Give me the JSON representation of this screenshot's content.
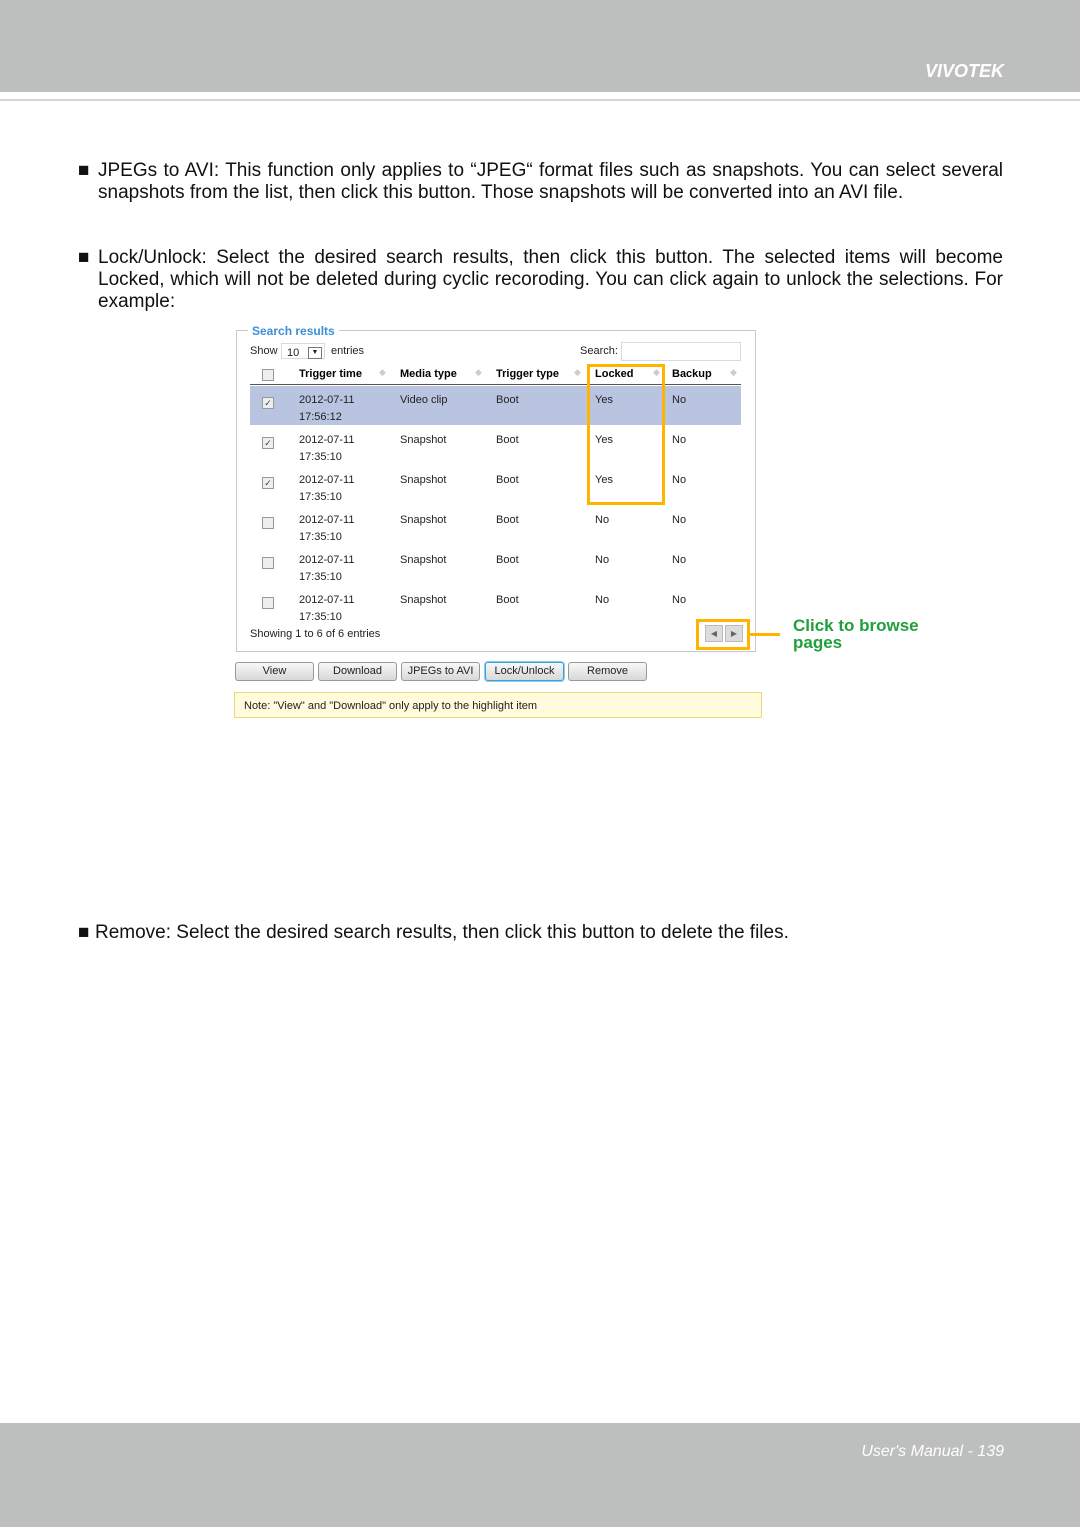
{
  "header": {
    "brand": "VIVOTEK"
  },
  "footer": {
    "page": "User's Manual - 139"
  },
  "paragraphs": [
    "JPEGs to AVI: This function only applies to “JPEG“ format files such as snapshots. You can select several snapshots from the list, then click this button. Those snapshots will be converted into an AVI file.",
    "Lock/Unlock: Select the desired search results, then click this button. The selected items will become Locked, which will not be deleted during cyclic recoroding. You can click again to unlock the selections. For example:",
    "Remove: Select the desired search results, then click this button to delete the files."
  ],
  "bullet": "■",
  "panel": {
    "legend": "Search results",
    "show": "Show",
    "entries_value": "10",
    "entries": "entries",
    "search_label": "Search:",
    "search_value": "",
    "columns": [
      "Trigger time",
      "Media type",
      "Trigger type",
      "Locked",
      "Backup"
    ],
    "rows": [
      {
        "checked": true,
        "date": "2012-07-11",
        "time": "17:56:12",
        "media": "Video clip",
        "trigger": "Boot",
        "locked": "Yes",
        "backup": "No",
        "highlight": true
      },
      {
        "checked": true,
        "date": "2012-07-11",
        "time": "17:35:10",
        "media": "Snapshot",
        "trigger": "Boot",
        "locked": "Yes",
        "backup": "No"
      },
      {
        "checked": true,
        "date": "2012-07-11",
        "time": "17:35:10",
        "media": "Snapshot",
        "trigger": "Boot",
        "locked": "Yes",
        "backup": "No"
      },
      {
        "checked": false,
        "date": "2012-07-11",
        "time": "17:35:10",
        "media": "Snapshot",
        "trigger": "Boot",
        "locked": "No",
        "backup": "No"
      },
      {
        "checked": false,
        "date": "2012-07-11",
        "time": "17:35:10",
        "media": "Snapshot",
        "trigger": "Boot",
        "locked": "No",
        "backup": "No"
      },
      {
        "checked": false,
        "date": "2012-07-11",
        "time": "17:35:10",
        "media": "Snapshot",
        "trigger": "Boot",
        "locked": "No",
        "backup": "No"
      }
    ],
    "showing": "Showing 1 to 6 of 6 entries",
    "buttons": [
      "View",
      "Download",
      "JPEGs to AVI",
      "Lock/Unlock",
      "Remove"
    ],
    "note": "Note: \"View\" and \"Download\" only apply to the highlight item"
  },
  "callout": "Click to browse pages",
  "colors": {
    "highlight": "#b8c4e0",
    "callout": "#ffb400",
    "callout_text": "#1fa03a",
    "legend": "#3a8fd6"
  }
}
